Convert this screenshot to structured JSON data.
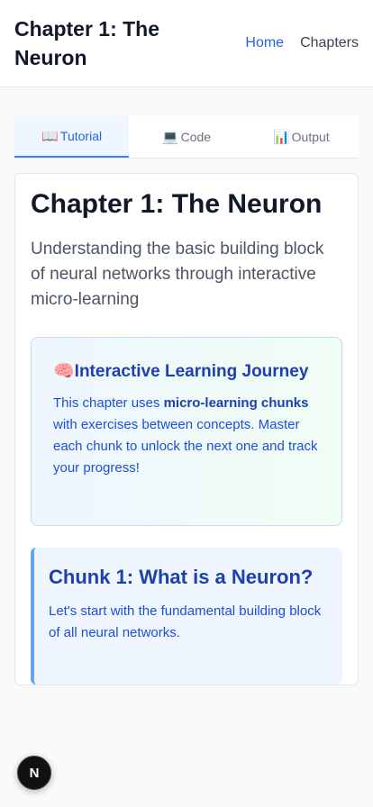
{
  "header": {
    "title": "Chapter 1: The Neuron",
    "nav": {
      "home": "Home",
      "chapters": "Chapters"
    }
  },
  "tabs": [
    {
      "icon": "📖",
      "label": "Tutorial",
      "active": true
    },
    {
      "icon": "💻",
      "label": "Code",
      "active": false
    },
    {
      "icon": "📊",
      "label": "Output",
      "active": false
    }
  ],
  "content": {
    "title": "Chapter 1: The Neuron",
    "subtitle": "Understanding the basic building block of neural networks through interactive micro-learning",
    "journey": {
      "icon": "🧠",
      "title": "Interactive Learning Journey",
      "text_before": "This chapter uses ",
      "text_bold": "micro-learning chunks",
      "text_after": " with exercises between concepts. Master each chunk to unlock the next one and track your progress!"
    },
    "chunk": {
      "title": "Chunk 1: What is a Neuron?",
      "text": "Let's start with the fundamental building block of all neural networks."
    }
  },
  "badge": {
    "label": "N"
  },
  "colors": {
    "accent": "#2563eb",
    "chunk_border": "#60a5fa",
    "journey_border": "#bfdbfe"
  }
}
